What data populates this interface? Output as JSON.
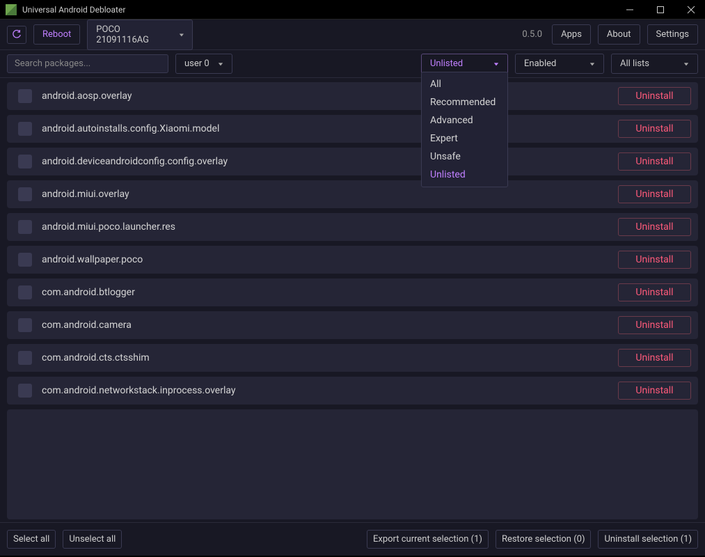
{
  "window": {
    "title": "Universal Android Debloater"
  },
  "toolbar": {
    "reboot_label": "Reboot",
    "device": "POCO 21091116AG",
    "version": "0.5.0",
    "apps_label": "Apps",
    "about_label": "About",
    "settings_label": "Settings"
  },
  "filters": {
    "search_placeholder": "Search packages...",
    "user": "user 0",
    "removal_list": "Unlisted",
    "state": "Enabled",
    "list_selection": "All lists",
    "removal_list_options": [
      "All",
      "Recommended",
      "Advanced",
      "Expert",
      "Unsafe",
      "Unlisted"
    ],
    "removal_list_selected": "Unlisted"
  },
  "packages": [
    {
      "name": "android.aosp.overlay",
      "action": "Uninstall"
    },
    {
      "name": "android.autoinstalls.config.Xiaomi.model",
      "action": "Uninstall"
    },
    {
      "name": "android.deviceandroidconfig.config.overlay",
      "action": "Uninstall"
    },
    {
      "name": "android.miui.overlay",
      "action": "Uninstall"
    },
    {
      "name": "android.miui.poco.launcher.res",
      "action": "Uninstall"
    },
    {
      "name": "android.wallpaper.poco",
      "action": "Uninstall"
    },
    {
      "name": "com.android.btlogger",
      "action": "Uninstall"
    },
    {
      "name": "com.android.camera",
      "action": "Uninstall"
    },
    {
      "name": "com.android.cts.ctsshim",
      "action": "Uninstall"
    },
    {
      "name": "com.android.networkstack.inprocess.overlay",
      "action": "Uninstall"
    }
  ],
  "footer": {
    "select_all": "Select all",
    "unselect_all": "Unselect all",
    "export": "Export current selection (1)",
    "restore": "Restore selection (0)",
    "uninstall": "Uninstall selection (1)"
  }
}
